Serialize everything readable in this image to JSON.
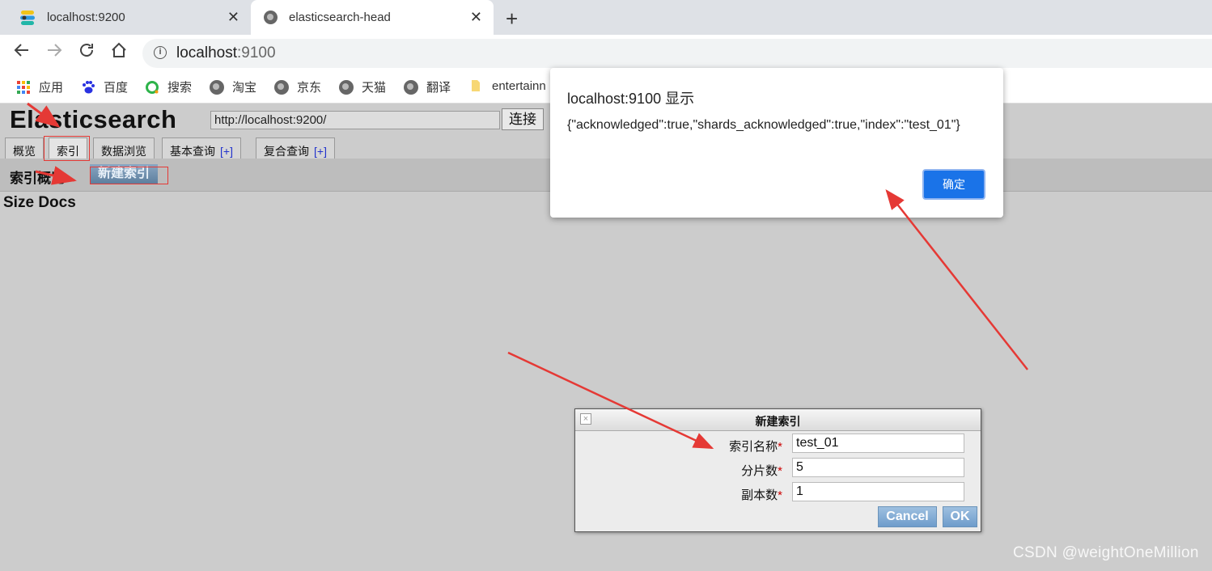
{
  "browser": {
    "tabs": [
      {
        "title": "localhost:9200",
        "icon": "elastic-icon"
      },
      {
        "title": "elasticsearch-head",
        "icon": "globe-icon",
        "active": true
      }
    ],
    "close_glyph": "✕",
    "new_tab_glyph": "+",
    "address": {
      "host": "localhost",
      "port": ":9100"
    },
    "bookmarks": [
      {
        "label": "应用",
        "icon": "apps-grid-icon"
      },
      {
        "label": "百度",
        "icon": "baidu-paw-icon"
      },
      {
        "label": "搜索",
        "icon": "search-circle-icon"
      },
      {
        "label": "淘宝",
        "icon": "globe-icon"
      },
      {
        "label": "京东",
        "icon": "globe-icon"
      },
      {
        "label": "天猫",
        "icon": "globe-icon"
      },
      {
        "label": "翻译",
        "icon": "globe-icon"
      },
      {
        "label": "entertainn",
        "icon": "folder-icon"
      }
    ]
  },
  "es_head": {
    "title": "Elasticsearch",
    "cluster_url": "http://localhost:9200/",
    "connect_label": "连接",
    "tabs": [
      {
        "label": "概览",
        "plus": ""
      },
      {
        "label": "索引",
        "plus": ""
      },
      {
        "label": "数据浏览",
        "plus": ""
      },
      {
        "label": "基本查询",
        "plus": "[+]"
      },
      {
        "label": "复合查询",
        "plus": "[+]"
      }
    ],
    "sub_title": "索引概览",
    "new_index_button": "新建索引",
    "columns": {
      "size": "Size",
      "docs": "Docs"
    }
  },
  "alert": {
    "title": "localhost:9100 显示",
    "message": "{\"acknowledged\":true,\"shards_acknowledged\":true,\"index\":\"test_01\"}",
    "ok_label": "确定"
  },
  "dialog": {
    "title": "新建索引",
    "required_mark": "*",
    "fields": [
      {
        "label": "索引名称",
        "value": "test_01"
      },
      {
        "label": "分片数",
        "value": "5"
      },
      {
        "label": "副本数",
        "value": "1"
      }
    ],
    "cancel_label": "Cancel",
    "ok_label": "OK"
  },
  "watermark": "CSDN @weightOneMillion",
  "colors": {
    "annotation_red": "#e53935",
    "alert_button_blue": "#1a73e8",
    "page_background": "#cccccc"
  }
}
